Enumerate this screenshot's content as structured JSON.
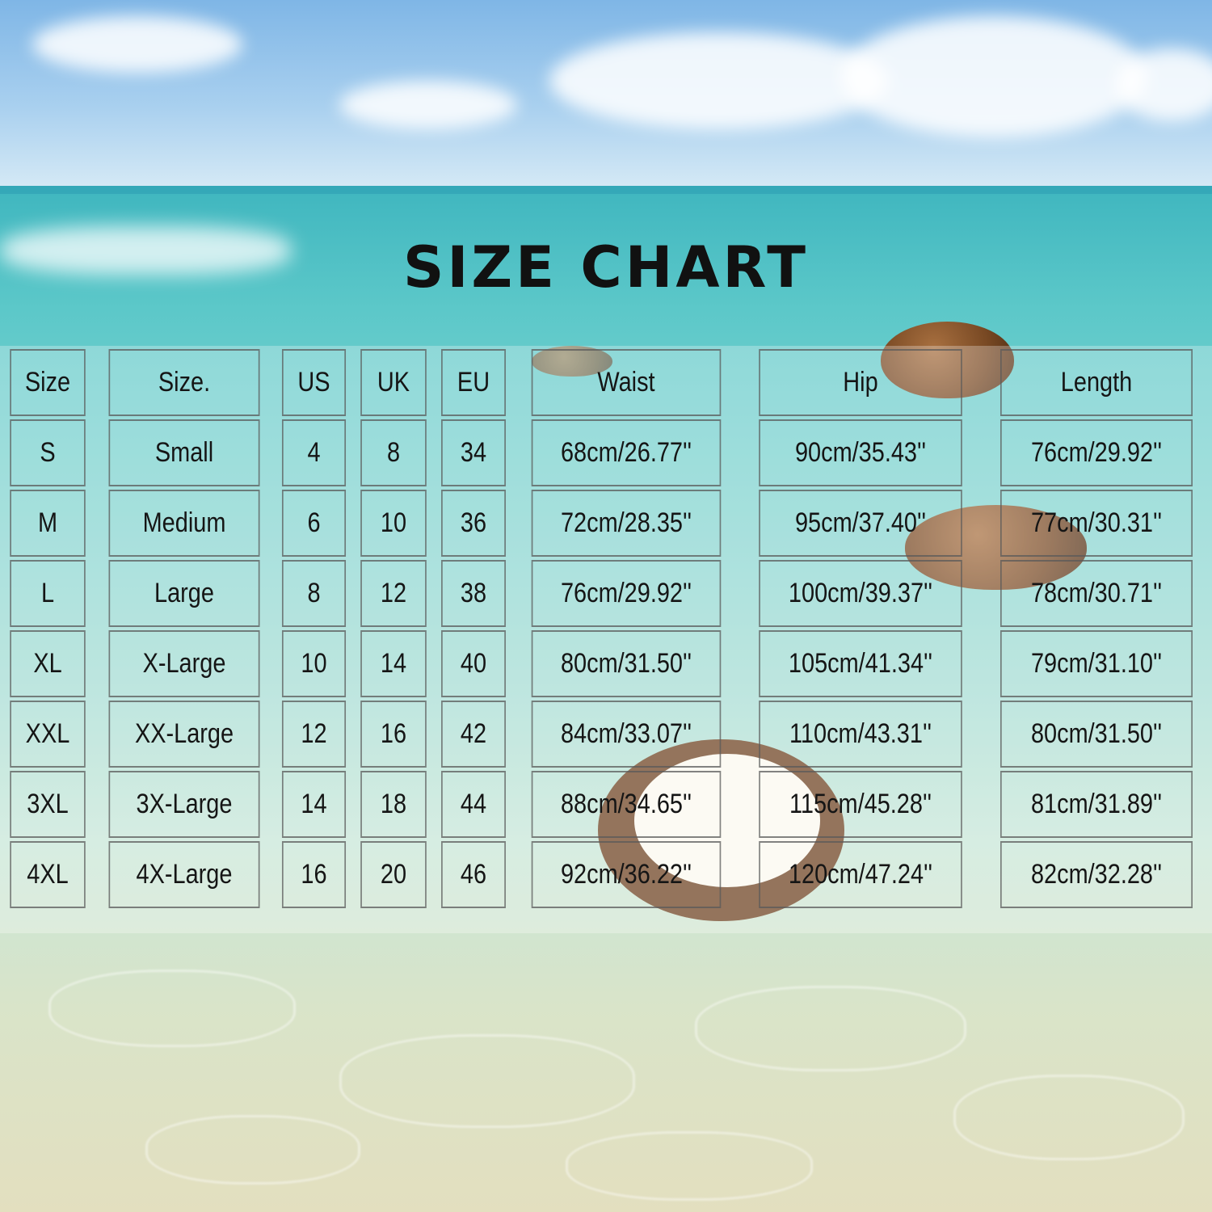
{
  "title": "SIZE CHART",
  "table": {
    "headers": [
      "Size",
      "Size.",
      "US",
      "UK",
      "EU",
      "Waist",
      "Hip",
      "Length"
    ],
    "rows": [
      [
        "S",
        "Small",
        "4",
        "8",
        "34",
        "68cm/26.77''",
        "90cm/35.43''",
        "76cm/29.92''"
      ],
      [
        "M",
        "Medium",
        "6",
        "10",
        "36",
        "72cm/28.35''",
        "95cm/37.40''",
        "77cm/30.31''"
      ],
      [
        "L",
        "Large",
        "8",
        "12",
        "38",
        "76cm/29.92''",
        "100cm/39.37''",
        "78cm/30.71''"
      ],
      [
        "XL",
        "X-Large",
        "10",
        "14",
        "40",
        "80cm/31.50''",
        "105cm/41.34''",
        "79cm/31.10''"
      ],
      [
        "XXL",
        "XX-Large",
        "12",
        "16",
        "42",
        "84cm/33.07''",
        "110cm/43.31''",
        "80cm/31.50''"
      ],
      [
        "3XL",
        "3X-Large",
        "14",
        "18",
        "44",
        "88cm/34.65''",
        "115cm/45.28''",
        "81cm/31.89''"
      ],
      [
        "4XL",
        "4X-Large",
        "16",
        "20",
        "46",
        "92cm/36.22''",
        "120cm/47.24''",
        "82cm/32.28''"
      ]
    ]
  },
  "background": {
    "description_icon": "beach-coconut-background",
    "colors": {
      "sky": "#9cc8ec",
      "sea": "#5cc8c9",
      "sand": "#e3dfbf",
      "text": "#151515"
    }
  }
}
